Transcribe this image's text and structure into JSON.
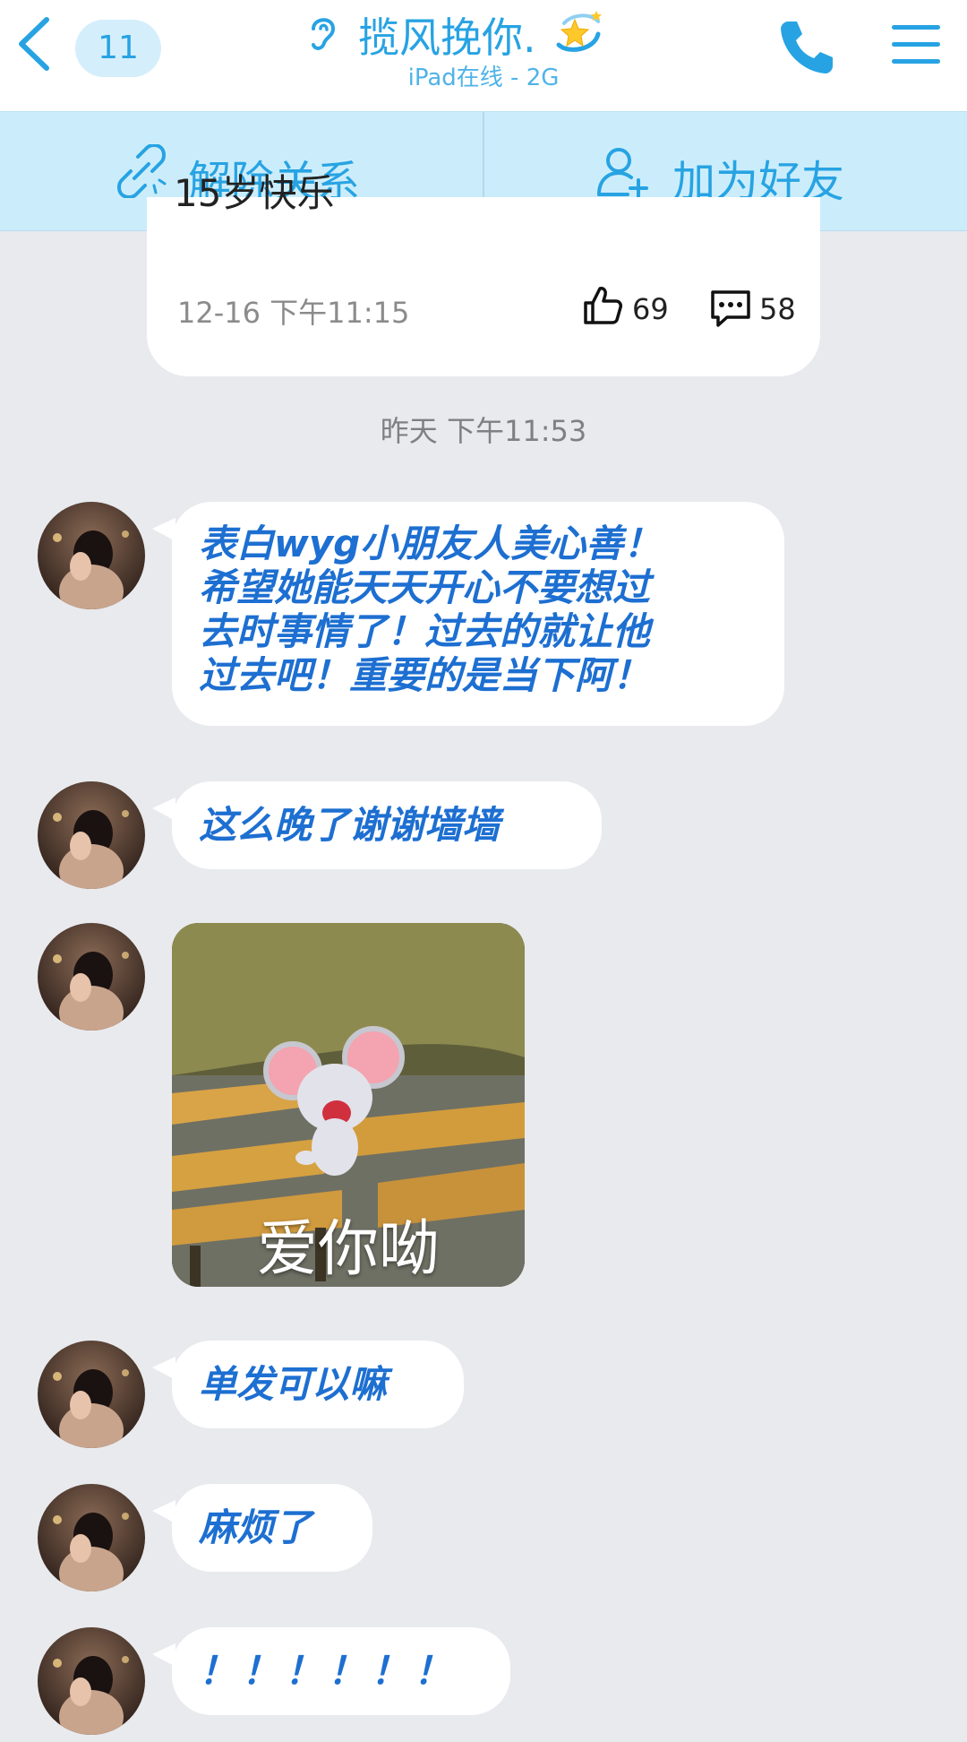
{
  "header": {
    "unread_count": "11",
    "title": "揽风挽你.",
    "subtitle": "iPad在线 - 2G",
    "accent_color": "#27a3e3"
  },
  "actions": {
    "remove_relationship": "解除关系",
    "add_friend": "加为好友"
  },
  "feed_card": {
    "snippet": "15岁快乐",
    "time": "12-16 下午11:15",
    "likes": "69",
    "comments": "58"
  },
  "timestamp": "昨天 下午11:53",
  "messages": [
    {
      "type": "text",
      "text": "表白wyg小朋友人美心善！\n希望她能天天开心不要想过\n去时事情了！过去的就让他\n过去吧！重要的是当下阿！"
    },
    {
      "type": "text",
      "text": "这么晚了谢谢墙墙"
    },
    {
      "type": "image",
      "caption": "爱你呦"
    },
    {
      "type": "text",
      "text": "单发可以嘛"
    },
    {
      "type": "text",
      "text": "麻烦了"
    },
    {
      "type": "text",
      "text": "！！！！！！"
    }
  ],
  "icons": {
    "back": "chevron-left-icon",
    "ear": "ear-icon",
    "title_decoration": "shooting-star-icon",
    "phone": "phone-icon",
    "menu": "hamburger-menu-icon",
    "unlink": "broken-link-icon",
    "add_friend": "user-plus-icon",
    "like": "thumbs-up-icon",
    "comment": "comment-icon"
  }
}
